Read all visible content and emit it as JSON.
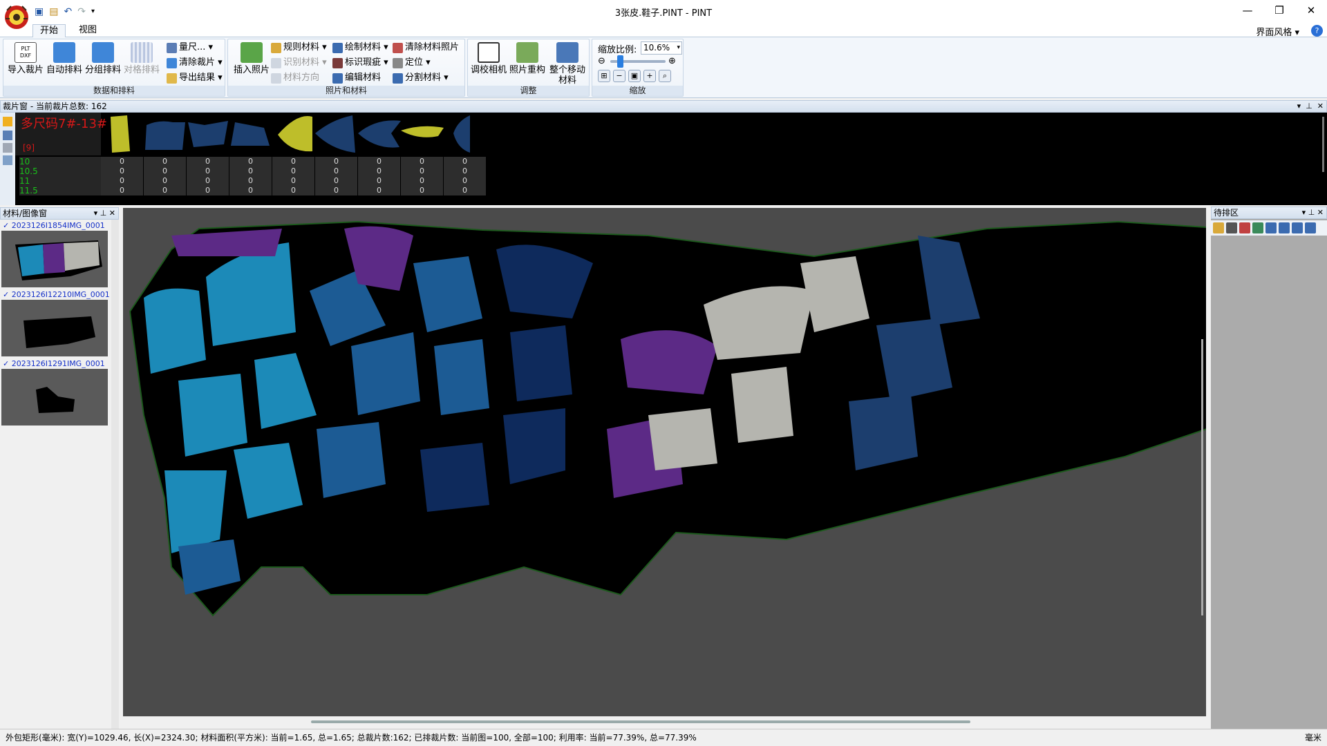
{
  "app": {
    "title": "3张皮.鞋子.PINT - PINT",
    "controls": {
      "minimize": "—",
      "maximize": "❐",
      "close": "✕"
    }
  },
  "tabs": {
    "start": "开始",
    "view": "视图"
  },
  "style_menu": "界面风格",
  "ribbon": {
    "groups": {
      "data": "数据和排料",
      "photo": "照片和材料",
      "adjust": "调整",
      "zoom": "缩放"
    },
    "data": {
      "import": "导入裁片",
      "auto": "自动排料",
      "group": "分组排料",
      "grid": "对格排料",
      "measure": "量尺...",
      "clear": "清除裁片",
      "export": "导出结果"
    },
    "photo": {
      "insert": "插入照片",
      "rule": "规则材料",
      "identify": "识别材料",
      "direction": "材料方向",
      "draw": "绘制材料",
      "mark_defect": "标识瑕疵",
      "edit": "编辑材料",
      "clear_photo": "清除材料照片",
      "locate": "定位",
      "split": "分割材料"
    },
    "adjust": {
      "calibrate": "调校相机",
      "rebuild": "照片重构",
      "move_line1": "整个移动",
      "move_line2": "材料"
    },
    "zoom": {
      "label": "缩放比例:",
      "value": "10.6%"
    }
  },
  "pieces_panel": {
    "title": "裁片窗 - 当前裁片总数: 162",
    "size_title": "多尺码7#-13#",
    "count": "[9]",
    "sizes": [
      "10",
      "10.5",
      "11",
      "11.5"
    ],
    "cell_value": "0"
  },
  "material_panel": {
    "title": "材料/图像窗",
    "items": [
      "2023126I1854IMG_0001",
      "2023126I12210IMG_0001",
      "2023126I1291IMG_0001"
    ]
  },
  "pending_panel": {
    "title": "待排区"
  },
  "colors": {
    "cyan": "#1c8ab8",
    "blue": "#1c5b94",
    "navy": "#0e2a5c",
    "purple": "#5c2a86",
    "gray": "#b5b5af",
    "yellow": "#bebe2a"
  },
  "status": {
    "text": "外包矩形(毫米): 宽(Y)=1029.46, 长(X)=2324.30;  材料面积(平方米): 当前=1.65, 总=1.65;  总裁片数:162;  已排裁片数: 当前图=100, 全部=100;  利用率: 当前=77.39%, 总=77.39%",
    "unit": "毫米"
  }
}
